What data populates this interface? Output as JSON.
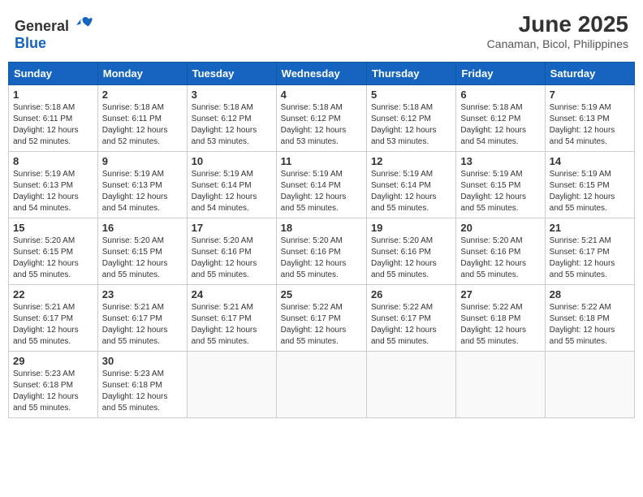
{
  "header": {
    "logo_general": "General",
    "logo_blue": "Blue",
    "month": "June 2025",
    "location": "Canaman, Bicol, Philippines"
  },
  "weekdays": [
    "Sunday",
    "Monday",
    "Tuesday",
    "Wednesday",
    "Thursday",
    "Friday",
    "Saturday"
  ],
  "weeks": [
    [
      {
        "day": "1",
        "info": "Sunrise: 5:18 AM\nSunset: 6:11 PM\nDaylight: 12 hours\nand 52 minutes."
      },
      {
        "day": "2",
        "info": "Sunrise: 5:18 AM\nSunset: 6:11 PM\nDaylight: 12 hours\nand 52 minutes."
      },
      {
        "day": "3",
        "info": "Sunrise: 5:18 AM\nSunset: 6:12 PM\nDaylight: 12 hours\nand 53 minutes."
      },
      {
        "day": "4",
        "info": "Sunrise: 5:18 AM\nSunset: 6:12 PM\nDaylight: 12 hours\nand 53 minutes."
      },
      {
        "day": "5",
        "info": "Sunrise: 5:18 AM\nSunset: 6:12 PM\nDaylight: 12 hours\nand 53 minutes."
      },
      {
        "day": "6",
        "info": "Sunrise: 5:18 AM\nSunset: 6:12 PM\nDaylight: 12 hours\nand 54 minutes."
      },
      {
        "day": "7",
        "info": "Sunrise: 5:19 AM\nSunset: 6:13 PM\nDaylight: 12 hours\nand 54 minutes."
      }
    ],
    [
      {
        "day": "8",
        "info": "Sunrise: 5:19 AM\nSunset: 6:13 PM\nDaylight: 12 hours\nand 54 minutes."
      },
      {
        "day": "9",
        "info": "Sunrise: 5:19 AM\nSunset: 6:13 PM\nDaylight: 12 hours\nand 54 minutes."
      },
      {
        "day": "10",
        "info": "Sunrise: 5:19 AM\nSunset: 6:14 PM\nDaylight: 12 hours\nand 54 minutes."
      },
      {
        "day": "11",
        "info": "Sunrise: 5:19 AM\nSunset: 6:14 PM\nDaylight: 12 hours\nand 55 minutes."
      },
      {
        "day": "12",
        "info": "Sunrise: 5:19 AM\nSunset: 6:14 PM\nDaylight: 12 hours\nand 55 minutes."
      },
      {
        "day": "13",
        "info": "Sunrise: 5:19 AM\nSunset: 6:15 PM\nDaylight: 12 hours\nand 55 minutes."
      },
      {
        "day": "14",
        "info": "Sunrise: 5:19 AM\nSunset: 6:15 PM\nDaylight: 12 hours\nand 55 minutes."
      }
    ],
    [
      {
        "day": "15",
        "info": "Sunrise: 5:20 AM\nSunset: 6:15 PM\nDaylight: 12 hours\nand 55 minutes."
      },
      {
        "day": "16",
        "info": "Sunrise: 5:20 AM\nSunset: 6:15 PM\nDaylight: 12 hours\nand 55 minutes."
      },
      {
        "day": "17",
        "info": "Sunrise: 5:20 AM\nSunset: 6:16 PM\nDaylight: 12 hours\nand 55 minutes."
      },
      {
        "day": "18",
        "info": "Sunrise: 5:20 AM\nSunset: 6:16 PM\nDaylight: 12 hours\nand 55 minutes."
      },
      {
        "day": "19",
        "info": "Sunrise: 5:20 AM\nSunset: 6:16 PM\nDaylight: 12 hours\nand 55 minutes."
      },
      {
        "day": "20",
        "info": "Sunrise: 5:20 AM\nSunset: 6:16 PM\nDaylight: 12 hours\nand 55 minutes."
      },
      {
        "day": "21",
        "info": "Sunrise: 5:21 AM\nSunset: 6:17 PM\nDaylight: 12 hours\nand 55 minutes."
      }
    ],
    [
      {
        "day": "22",
        "info": "Sunrise: 5:21 AM\nSunset: 6:17 PM\nDaylight: 12 hours\nand 55 minutes."
      },
      {
        "day": "23",
        "info": "Sunrise: 5:21 AM\nSunset: 6:17 PM\nDaylight: 12 hours\nand 55 minutes."
      },
      {
        "day": "24",
        "info": "Sunrise: 5:21 AM\nSunset: 6:17 PM\nDaylight: 12 hours\nand 55 minutes."
      },
      {
        "day": "25",
        "info": "Sunrise: 5:22 AM\nSunset: 6:17 PM\nDaylight: 12 hours\nand 55 minutes."
      },
      {
        "day": "26",
        "info": "Sunrise: 5:22 AM\nSunset: 6:17 PM\nDaylight: 12 hours\nand 55 minutes."
      },
      {
        "day": "27",
        "info": "Sunrise: 5:22 AM\nSunset: 6:18 PM\nDaylight: 12 hours\nand 55 minutes."
      },
      {
        "day": "28",
        "info": "Sunrise: 5:22 AM\nSunset: 6:18 PM\nDaylight: 12 hours\nand 55 minutes."
      }
    ],
    [
      {
        "day": "29",
        "info": "Sunrise: 5:23 AM\nSunset: 6:18 PM\nDaylight: 12 hours\nand 55 minutes."
      },
      {
        "day": "30",
        "info": "Sunrise: 5:23 AM\nSunset: 6:18 PM\nDaylight: 12 hours\nand 55 minutes."
      },
      {
        "day": "",
        "info": ""
      },
      {
        "day": "",
        "info": ""
      },
      {
        "day": "",
        "info": ""
      },
      {
        "day": "",
        "info": ""
      },
      {
        "day": "",
        "info": ""
      }
    ]
  ]
}
